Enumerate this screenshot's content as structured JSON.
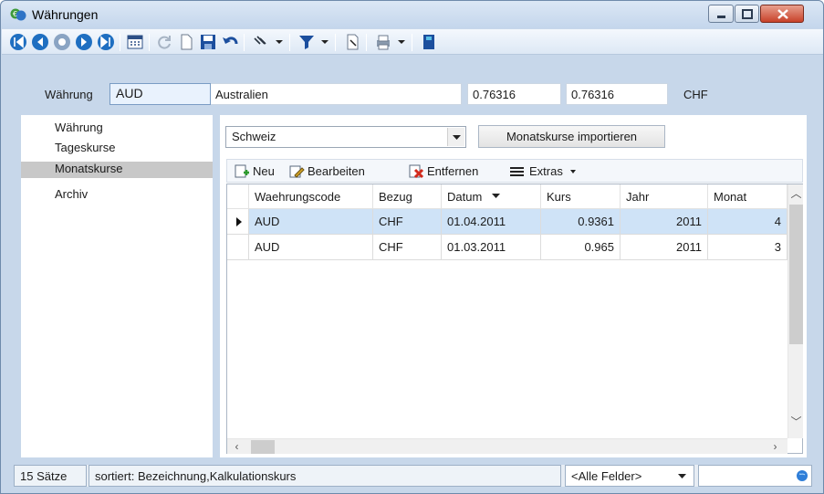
{
  "window": {
    "title": "Währungen"
  },
  "toolbar": {
    "icons": [
      "first-record-icon",
      "prev-page-icon",
      "refresh-circle-icon",
      "next-icon",
      "last-record-icon",
      "calculator-icon",
      "reload-icon",
      "new-doc-icon",
      "save-icon",
      "undo-icon",
      "pin-icon",
      "filter-icon",
      "print-preview-icon",
      "print-icon",
      "book-icon"
    ]
  },
  "header": {
    "currency_label": "Währung",
    "currency_value": "AUD",
    "country": "Australien",
    "rate1": "0.76316",
    "rate2": "0.76316",
    "base": "CHF"
  },
  "nav": {
    "items": [
      {
        "label": "Währung"
      },
      {
        "label": "Tageskurse"
      },
      {
        "label": "Monatskurse",
        "selected": true
      },
      {
        "label": "Archiv"
      }
    ]
  },
  "main": {
    "country_select": "Schweiz",
    "import_button": "Monatskurse importieren",
    "grid_toolbar": {
      "new": "Neu",
      "edit": "Bearbeiten",
      "remove": "Entfernen",
      "extras": "Extras"
    },
    "columns": [
      "Waehrungscode",
      "Bezug",
      "Datum",
      "Kurs",
      "Jahr",
      "Monat"
    ],
    "rows": [
      {
        "code": "AUD",
        "bezug": "CHF",
        "datum": "01.04.2011",
        "kurs": "0.9361",
        "jahr": "2011",
        "monat": "4"
      },
      {
        "code": "AUD",
        "bezug": "CHF",
        "datum": "01.03.2011",
        "kurs": "0.965",
        "jahr": "2011",
        "monat": "3"
      }
    ]
  },
  "status": {
    "count": "15 Sätze",
    "sorted": "sortiert: Bezeichnung,Kalkulationskurs",
    "field_filter": "<Alle Felder>",
    "search": ""
  },
  "colors": {
    "accent": "#1f6fc1",
    "selection": "#cfe3f7",
    "close": "#c8422a"
  }
}
